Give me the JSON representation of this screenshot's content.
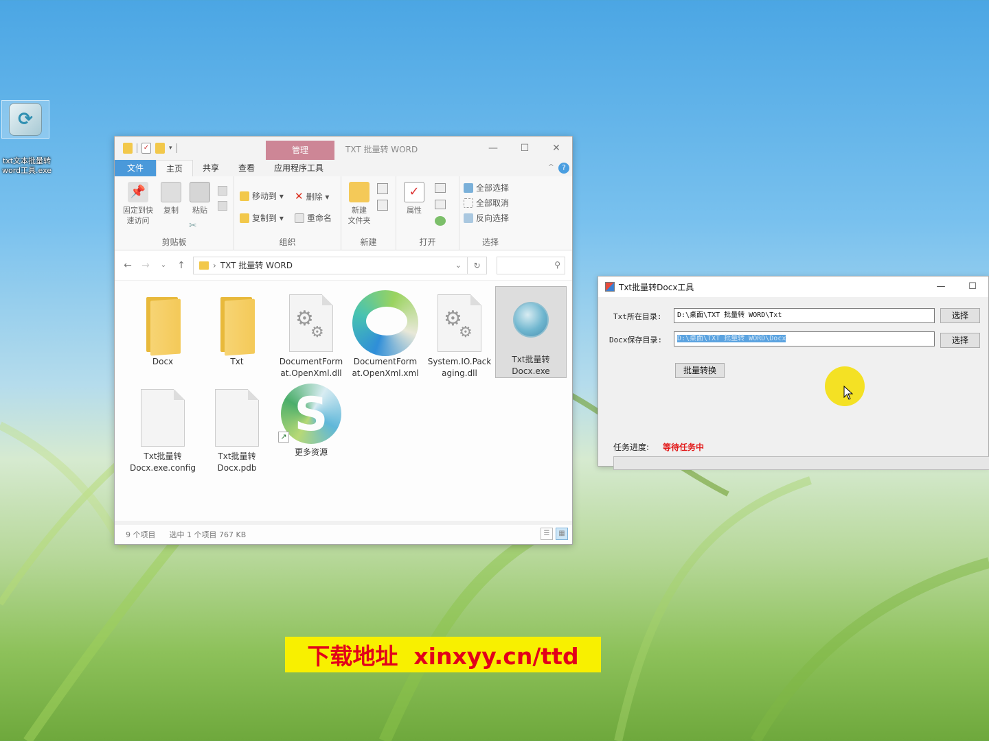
{
  "desktop": {
    "icon_label": "txt文本批量转\nword工具.exe"
  },
  "explorer": {
    "title": "TXT 批量转 WORD",
    "context_tab": "管理",
    "window_buttons": {
      "minimize": "—",
      "maximize": "☐",
      "close": "✕"
    },
    "tabs": [
      "文件",
      "主页",
      "共享",
      "查看",
      "应用程序工具"
    ],
    "help": "?",
    "collapse": "^",
    "ribbon": {
      "clipboard": {
        "name": "剪贴板",
        "pin": "固定到快\n速访问",
        "copy": "复制",
        "paste": "粘贴"
      },
      "organize": {
        "name": "组织",
        "move_to": "移动到 ▾",
        "copy_to": "复制到 ▾",
        "delete": "删除 ▾",
        "rename": "重命名"
      },
      "new": {
        "name": "新建",
        "new_folder": "新建\n文件夹"
      },
      "open": {
        "name": "打开",
        "properties": "属性"
      },
      "select": {
        "name": "选择",
        "select_all": "全部选择",
        "select_none": "全部取消",
        "invert": "反向选择"
      }
    },
    "address": {
      "back": "←",
      "forward": "→",
      "recent": "⌄",
      "up": "↑",
      "path": "TXT 批量转 WORD",
      "dropdown": "⌄",
      "refresh": "↻",
      "search_icon": "⚲"
    },
    "files": [
      {
        "name": "Docx",
        "type": "folder",
        "selected": false
      },
      {
        "name": "Txt",
        "type": "folder",
        "selected": false
      },
      {
        "name": "DocumentForm\nat.OpenXml.dll",
        "type": "dll",
        "selected": false
      },
      {
        "name": "DocumentForm\nat.OpenXml.xml",
        "type": "edge",
        "selected": false
      },
      {
        "name": "System.IO.Pack\naging.dll",
        "type": "dll",
        "selected": false
      },
      {
        "name": "Txt批量转\nDocx.exe",
        "type": "exe",
        "selected": true
      },
      {
        "name": "Txt批量转\nDocx.exe.config",
        "type": "doc",
        "selected": false
      },
      {
        "name": "Txt批量转\nDocx.pdb",
        "type": "doc",
        "selected": false
      },
      {
        "name": "更多资源",
        "type": "shortcut",
        "selected": false
      }
    ],
    "status": {
      "count": "9 个项目",
      "selected": "选中 1 个项目  767 KB"
    }
  },
  "dialog": {
    "title": "Txt批量转Docx工具",
    "window_buttons": {
      "minimize": "—",
      "maximize": "☐"
    },
    "txt_dir_label": "Txt所在目录:",
    "txt_dir_value": "D:\\桌面\\TXT 批量转 WORD\\Txt",
    "docx_dir_label": "Docx保存目录:",
    "docx_dir_value": "D:\\桌面\\TXT 批量转 WORD\\Docx",
    "choose_label": "选择",
    "convert_label": "批量转换",
    "progress_label": "任务进度:",
    "progress_status": "等待任务中",
    "progress_fraction": 0
  },
  "banner": {
    "text": "下载地址  xinxyy.cn/ttd"
  },
  "colors": {
    "banner_bg": "#f8f000",
    "banner_text": "#e2001a",
    "status_red": "#e21b1b",
    "file_tab": "#2d8ad6",
    "context_tab": "#c97b8c"
  }
}
